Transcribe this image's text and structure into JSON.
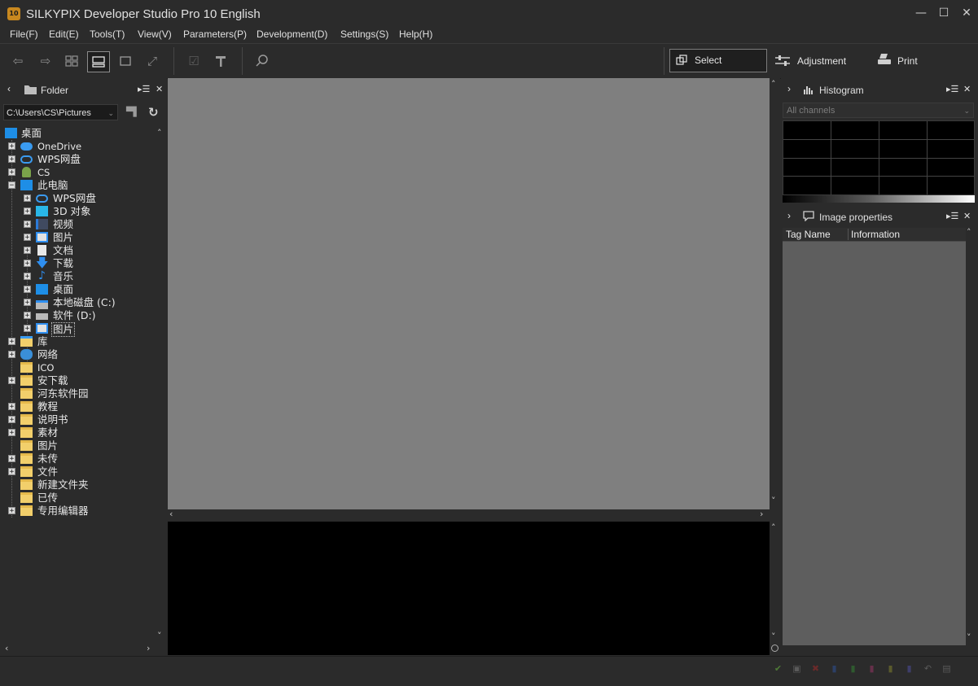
{
  "window": {
    "title": "SILKYPIX Developer Studio Pro 10 English",
    "icon_text": "10",
    "controls": {
      "minimize": "—",
      "maximize": "☐",
      "close": "✕"
    }
  },
  "menu": [
    "File(F)",
    "Edit(E)",
    "Tools(T)",
    "View(V)",
    "Parameters(P)",
    "Development(D)",
    "Settings(S)",
    "Help(H)"
  ],
  "modes": {
    "select": "Select",
    "adjustment": "Adjustment",
    "print": "Print"
  },
  "folder_panel": {
    "title": "Folder",
    "path": "C:\\Users\\CS\\Pictures"
  },
  "tree": [
    {
      "label": "桌面"
    },
    {
      "label": "OneDrive"
    },
    {
      "label": "WPS网盘"
    },
    {
      "label": "CS"
    },
    {
      "label": "此电脑"
    },
    {
      "label": "WPS网盘"
    },
    {
      "label": "3D 对象"
    },
    {
      "label": "视频"
    },
    {
      "label": "图片"
    },
    {
      "label": "文档"
    },
    {
      "label": "下载"
    },
    {
      "label": "音乐"
    },
    {
      "label": "桌面"
    },
    {
      "label": "本地磁盘 (C:)"
    },
    {
      "label": "软件 (D:)"
    },
    {
      "label": "图片"
    },
    {
      "label": "库"
    },
    {
      "label": "网络"
    },
    {
      "label": "ICO"
    },
    {
      "label": "安下载"
    },
    {
      "label": "河东软件园"
    },
    {
      "label": "教程"
    },
    {
      "label": "说明书"
    },
    {
      "label": "素材"
    },
    {
      "label": "图片"
    },
    {
      "label": "未传"
    },
    {
      "label": "文件"
    },
    {
      "label": "新建文件夹"
    },
    {
      "label": "已传"
    },
    {
      "label": "专用编辑器"
    }
  ],
  "histogram_panel": {
    "title": "Histogram",
    "channel": "All channels"
  },
  "properties_panel": {
    "title": "Image properties",
    "columns": [
      "Tag Name",
      "Information"
    ]
  },
  "colors": {
    "background": "#2b2b2b",
    "viewer": "#7f7f7f",
    "accent_folder": "#f2cf6b",
    "accent_blue": "#1e8ee6"
  }
}
